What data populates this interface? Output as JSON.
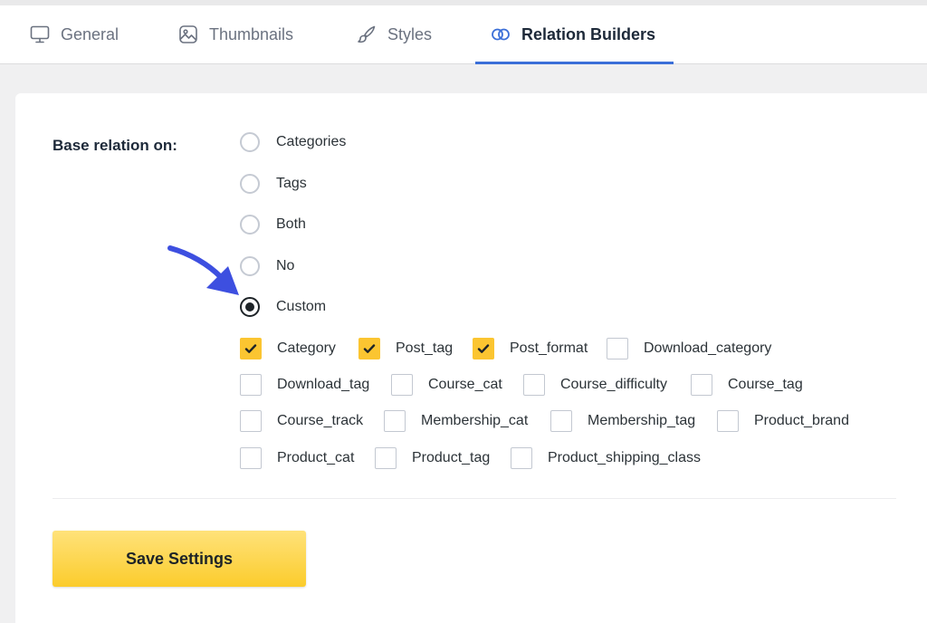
{
  "tabs": [
    {
      "label": "General",
      "icon": "monitor-icon",
      "active": false
    },
    {
      "label": "Thumbnails",
      "icon": "image-icon",
      "active": false
    },
    {
      "label": "Styles",
      "icon": "brush-icon",
      "active": false
    },
    {
      "label": "Relation Builders",
      "icon": "link-rings-icon",
      "active": true
    }
  ],
  "form": {
    "base_relation_label": "Base relation on:",
    "radio_options": [
      {
        "label": "Categories",
        "checked": false
      },
      {
        "label": "Tags",
        "checked": false
      },
      {
        "label": "Both",
        "checked": false
      },
      {
        "label": "No",
        "checked": false
      },
      {
        "label": "Custom",
        "checked": true
      }
    ],
    "taxonomies": [
      {
        "label": "Category",
        "checked": true
      },
      {
        "label": "Post_tag",
        "checked": true
      },
      {
        "label": "Post_format",
        "checked": true
      },
      {
        "label": "Download_category",
        "checked": false
      },
      {
        "label": "Download_tag",
        "checked": false
      },
      {
        "label": "Course_cat",
        "checked": false
      },
      {
        "label": "Course_difficulty",
        "checked": false
      },
      {
        "label": "Course_tag",
        "checked": false
      },
      {
        "label": "Course_track",
        "checked": false
      },
      {
        "label": "Membership_cat",
        "checked": false
      },
      {
        "label": "Membership_tag",
        "checked": false
      },
      {
        "label": "Product_brand",
        "checked": false
      },
      {
        "label": "Product_cat",
        "checked": false
      },
      {
        "label": "Product_tag",
        "checked": false
      },
      {
        "label": "Product_shipping_class",
        "checked": false
      }
    ],
    "save_label": "Save Settings"
  },
  "colors": {
    "accent_tab": "#3b6fd8",
    "checkbox_checked": "#fbc531",
    "save_button": "#fbcc2c",
    "annotation_arrow": "#3d4fe0"
  }
}
